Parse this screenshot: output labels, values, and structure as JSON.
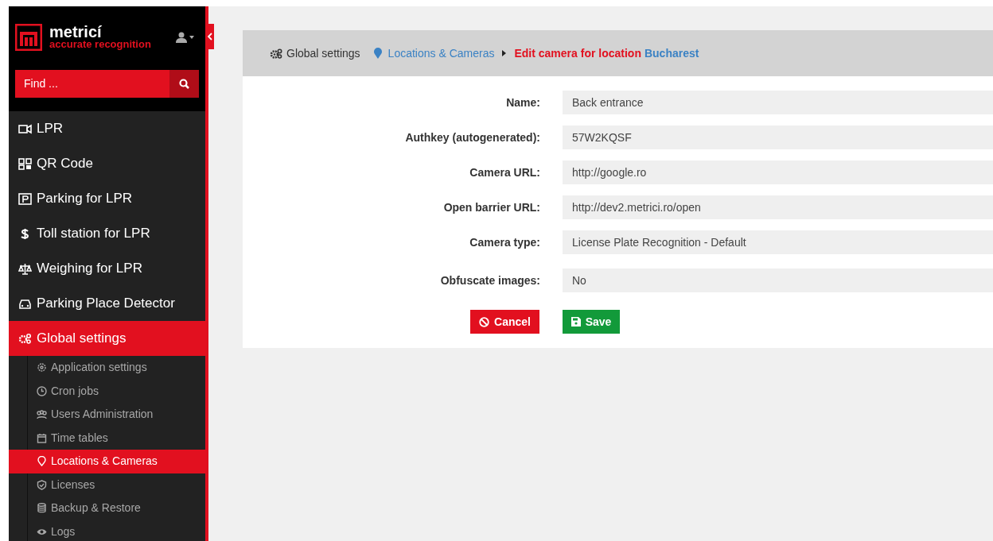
{
  "brand": {
    "name": "metricí",
    "tagline": "accurate recognition"
  },
  "search": {
    "placeholder": "Find ..."
  },
  "sidebar": {
    "items": [
      {
        "label": "LPR",
        "selected": false
      },
      {
        "label": "QR Code",
        "selected": false
      },
      {
        "label": "Parking for LPR",
        "selected": false
      },
      {
        "label": "Toll station for LPR",
        "selected": false
      },
      {
        "label": "Weighing for LPR",
        "selected": false
      },
      {
        "label": "Parking Place Detector",
        "selected": false
      },
      {
        "label": "Global settings",
        "selected": true,
        "children": [
          {
            "label": "Application settings",
            "selected": false
          },
          {
            "label": "Cron jobs",
            "selected": false
          },
          {
            "label": "Users Administration",
            "selected": false
          },
          {
            "label": "Time tables",
            "selected": false
          },
          {
            "label": "Locations & Cameras",
            "selected": true
          },
          {
            "label": "Licenses",
            "selected": false
          },
          {
            "label": "Backup & Restore",
            "selected": false
          },
          {
            "label": "Logs",
            "selected": false
          }
        ]
      }
    ]
  },
  "breadcrumb": {
    "root": "Global settings",
    "parent": "Locations & Cameras",
    "current": "Edit camera for location",
    "location": "Bucharest"
  },
  "form": {
    "fields": [
      {
        "label": "Name:",
        "value": "Back entrance"
      },
      {
        "label": "Authkey (autogenerated):",
        "value": "57W2KQSF"
      },
      {
        "label": "Camera URL:",
        "value": "http://google.ro"
      },
      {
        "label": "Open barrier URL:",
        "value": "http://dev2.metrici.ro/open"
      },
      {
        "label": "Camera type:",
        "value": "License Plate Recognition - Default"
      },
      {
        "label": "Obfuscate images:",
        "value": "No"
      }
    ],
    "buttons": [
      {
        "kind": "cancel",
        "label": "Cancel"
      },
      {
        "kind": "save",
        "label": "Save"
      }
    ]
  }
}
